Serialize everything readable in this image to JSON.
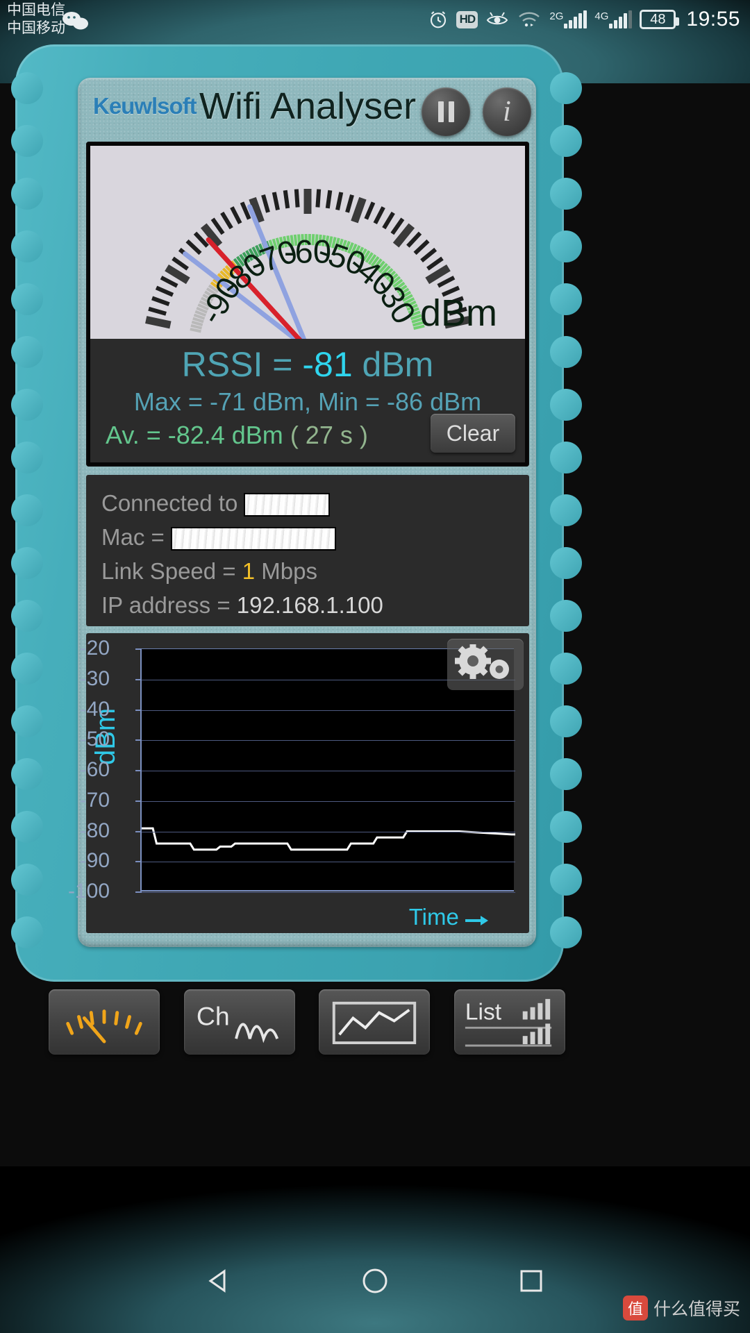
{
  "status_bar": {
    "carrier_1": "中国电信",
    "carrier_2": "中国移动",
    "time": "19:55",
    "battery_percent": "48",
    "hd_label": "HD",
    "net_2g": "2G",
    "net_4g": "4G",
    "icons": [
      "alarm-icon",
      "hd-icon",
      "eye-icon",
      "wifi-icon",
      "signal-2g-icon",
      "signal-4g-icon",
      "battery-icon"
    ]
  },
  "app": {
    "brand": "Keuwlsoft",
    "title": "Wifi Analyser",
    "pause_label": "pause-icon",
    "info_label": "i"
  },
  "gauge": {
    "unit_label": "dBm",
    "tick_labels": [
      "-90",
      "-80",
      "-70",
      "-60",
      "-50",
      "-40",
      "-30"
    ],
    "needle_value": -81,
    "needle_color": "#d8212b",
    "marker_color": "#8fa2e0",
    "max_marker": -71,
    "min_marker": -86,
    "scale_min": -100,
    "scale_max": -20
  },
  "readout": {
    "rssi_prefix": "RSSI = ",
    "rssi_value": "-81",
    "rssi_suffix": " dBm",
    "minmax": "Max = -71 dBm,  Min = -86 dBm",
    "average_prefix": "Av. = -82.4 dBm",
    "average_seconds": "( 27 s )",
    "clear_label": "Clear"
  },
  "connection": {
    "connected_label": "Connected to",
    "ssid_value": "",
    "mac_label": "Mac =",
    "mac_value": "",
    "link_speed_label": "Link Speed = ",
    "link_speed_value": "1",
    "link_speed_unit": " Mbps",
    "ip_label": "IP address = ",
    "ip_value": "192.168.1.100"
  },
  "graph": {
    "y_axis_title": "dBm",
    "x_axis_title": "Time",
    "settings_icon": "gears-icon"
  },
  "chart_data": {
    "type": "line",
    "title": "",
    "xlabel": "Time",
    "ylabel": "dBm",
    "ylim": [
      -100,
      -20
    ],
    "yticks": [
      -20,
      -30,
      -40,
      -50,
      -60,
      -70,
      -80,
      -90,
      -100
    ],
    "grid": true,
    "legend": "none",
    "line_color": "#ffffff",
    "x": [
      0,
      3,
      4,
      13,
      14,
      20,
      21,
      24,
      25,
      28,
      29,
      39,
      40,
      50,
      51,
      55,
      56,
      62,
      63,
      70,
      71,
      84,
      85,
      99,
      100
    ],
    "values": [
      -79,
      -79,
      -84,
      -84,
      -86,
      -86,
      -85,
      -85,
      -84,
      -84,
      -84,
      -84,
      -86,
      -86,
      -86,
      -86,
      -84,
      -84,
      -82,
      -82,
      -80,
      -80,
      -80,
      -81,
      -81
    ]
  },
  "tabs": [
    {
      "name": "gauge-tab",
      "label": "",
      "icon": "gauge-icon"
    },
    {
      "name": "channel-tab",
      "label": "Ch",
      "icon": "channel-icon"
    },
    {
      "name": "graph-tab",
      "label": "",
      "icon": "graph-icon"
    },
    {
      "name": "list-tab",
      "label": "List",
      "icon": "list-icon"
    }
  ],
  "nav_bar": {
    "back": "back-triangle-icon",
    "home": "home-circle-icon",
    "recents": "recents-square-icon"
  },
  "watermark": {
    "mark": "值",
    "text": "什么值得买"
  },
  "colors": {
    "case_teal": "#3fa7b4",
    "panel_dark": "#2b2b2b",
    "accent_cyan": "#2fc9e8",
    "green": "#63c68d",
    "gold": "#f3c028"
  }
}
